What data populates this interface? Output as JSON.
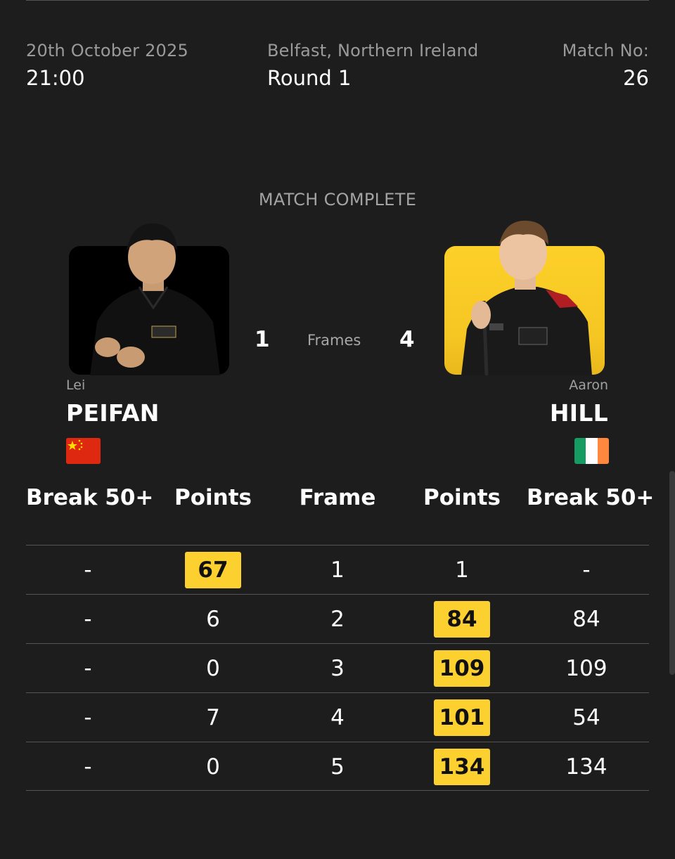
{
  "match": {
    "date": "20th October 2025",
    "time": "21:00",
    "venue": "Belfast, Northern Ireland",
    "round": "Round 1",
    "match_no_label": "Match No:",
    "match_no": "26",
    "status": "MATCH COMPLETE",
    "frames_label": "Frames"
  },
  "player_left": {
    "first_name": "Lei",
    "last_name": "PEIFAN",
    "frames": "1",
    "flag": "china-flag-icon",
    "card_color": "#000000"
  },
  "player_right": {
    "first_name": "Aaron",
    "last_name": "HILL",
    "frames": "4",
    "flag": "ireland-flag-icon",
    "card_color": "#fdd028"
  },
  "table": {
    "headers": [
      "Break 50+",
      "Points",
      "Frame",
      "Points",
      "Break 50+"
    ],
    "rows": [
      {
        "left_break": "-",
        "left_points": "67",
        "frame": "1",
        "right_points": "1",
        "right_break": "-",
        "winner": "left"
      },
      {
        "left_break": "-",
        "left_points": "6",
        "frame": "2",
        "right_points": "84",
        "right_break": "84",
        "winner": "right"
      },
      {
        "left_break": "-",
        "left_points": "0",
        "frame": "3",
        "right_points": "109",
        "right_break": "109",
        "winner": "right"
      },
      {
        "left_break": "-",
        "left_points": "7",
        "frame": "4",
        "right_points": "101",
        "right_break": "54",
        "winner": "right"
      },
      {
        "left_break": "-",
        "left_points": "0",
        "frame": "5",
        "right_points": "134",
        "right_break": "134",
        "winner": "right"
      }
    ]
  },
  "colors": {
    "background": "#1d1d1d",
    "accent_yellow": "#fcd02e",
    "divider": "#555555"
  }
}
